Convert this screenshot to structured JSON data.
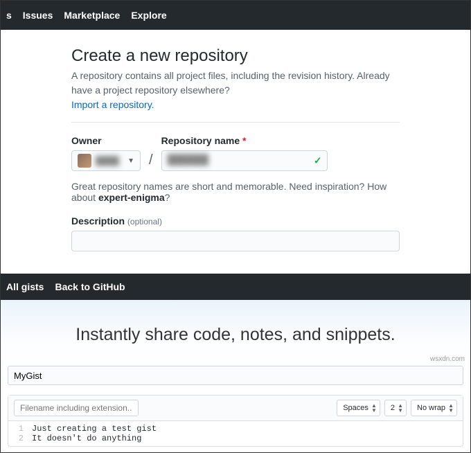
{
  "top_nav": {
    "items": [
      "s",
      "Issues",
      "Marketplace",
      "Explore"
    ]
  },
  "create_repo": {
    "title": "Create a new repository",
    "subtitle": "A repository contains all project files, including the revision history. Already have a project repository elsewhere?",
    "import_link": "Import a repository.",
    "owner_label": "Owner",
    "repo_label": "Repository name",
    "required_marker": "*",
    "slash": "/",
    "check_icon": "✓",
    "hint_prefix": "Great repository names are short and memorable. Need inspiration? How about ",
    "hint_suggestion": "expert-enigma",
    "hint_suffix": "?",
    "desc_label": "Description",
    "desc_optional": "(optional)"
  },
  "gist_nav": {
    "items": [
      "All gists",
      "Back to GitHub"
    ]
  },
  "gist": {
    "hero": "Instantly share code, notes, and snippets.",
    "description_value": "MyGist",
    "filename_placeholder": "Filename including extension...",
    "indent_mode": "Spaces",
    "indent_size": "2",
    "wrap_mode": "No wrap",
    "code": [
      "Just creating a test gist",
      "It doesn't do anything"
    ]
  },
  "watermark": "wsxdn.com"
}
